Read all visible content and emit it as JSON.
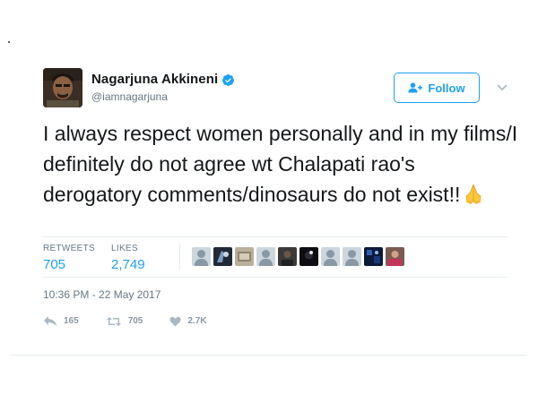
{
  "author": {
    "name": "Nagarjuna Akkineni",
    "handle": "@iamnagarjuna",
    "verified": true
  },
  "follow_button": {
    "label": "Follow",
    "icon": "add-user-icon"
  },
  "tweet": {
    "text": "I always respect women personally and in my films/I definitely do not agree wt Chalapati rao's derogatory comments/dinosaurs do not exist!!",
    "emoji": "folded-hands-icon"
  },
  "stats": {
    "retweets_label": "RETWEETS",
    "retweets_value": "705",
    "likes_label": "LIKES",
    "likes_value": "2,749"
  },
  "liked_by_avatar_count": 10,
  "timestamp": "10:36 PM - 22 May 2017",
  "actions": {
    "reply_count": "165",
    "retweet_count": "705",
    "like_count": "2.7K"
  },
  "colors": {
    "accent": "#1da1f2",
    "text": "#14171a",
    "muted": "#657786",
    "divider": "#e6ecf0"
  }
}
